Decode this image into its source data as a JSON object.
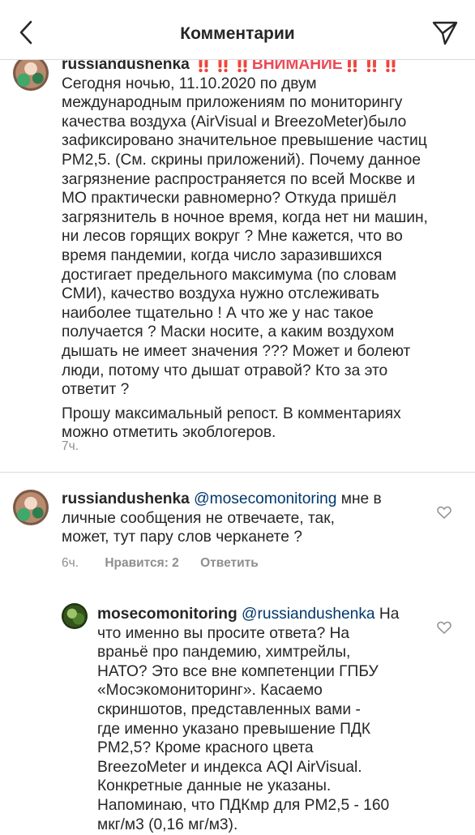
{
  "header": {
    "title": "Комментарии"
  },
  "caption": {
    "username": "russiandushenka",
    "warning": "‼️‼️‼️ВНИМАНИЕ‼️‼️‼️",
    "lines": [
      "Сегодня ночью, 11.10.2020 по двум",
      "международным  приложениям по мониторингу",
      "качества воздуха (AirVisual и BreezoMeter)было",
      "зафиксировано значительное превышение частиц",
      "PM2,5. (См. скрины приложений). Почему данное",
      "загрязнение распространяется по всей Москве и",
      "МО практически равномерно? Откуда пришёл",
      "загрязнитель в ночное время, когда нет ни машин,",
      "ни лесов горящих вокруг ? Мне кажется, что во",
      "время пандемии, когда число заразившихся",
      "достигает предельного максимума (по словам",
      "СМИ), качество воздуха нужно отслеживать",
      "наиболее тщательно ! А что же у нас такое",
      "получается ? Маски носите, а каким воздухом",
      "дышать не имеет значения ??? Может и болеют",
      "люди, потому что дышат отравой? Кто за это",
      "ответит ?"
    ],
    "lines2": [
      "Прошу максимальный репост. В комментариях",
      "можно отметить экоблогеров."
    ],
    "time": "7ч."
  },
  "comment1": {
    "username": "russiandushenka",
    "mention": "@mosecomonitoring",
    "first_line_rest": " мне в",
    "lines": [
      "личные сообщения не отвечаете, так,",
      "может, тут пару слов черканете ?"
    ],
    "time": "6ч.",
    "likes": "Нравится: 2",
    "reply": "Ответить"
  },
  "reply1": {
    "username": "mosecomonitoring",
    "mention": "@russiandushenka",
    "first_line_rest": " На",
    "lines": [
      "что именно вы просите ответа? На",
      "враньё про пандемию, химтрейлы,",
      "НАТО? Это все вне компетенции ГПБУ",
      "«Мосэкомониторинг». Касаемо",
      "скриншотов, представленных вами -",
      "где именно указано превышение ПДК",
      "PM2,5? Кроме красного цвета",
      "BreezoMeter и индекса AQI AirVisual.",
      "Конкретные данные не указаны.",
      "Напоминаю, что ПДКмр для PM2,5 - 160",
      "мкг/м3 (0,16 мг/м3)."
    ]
  }
}
